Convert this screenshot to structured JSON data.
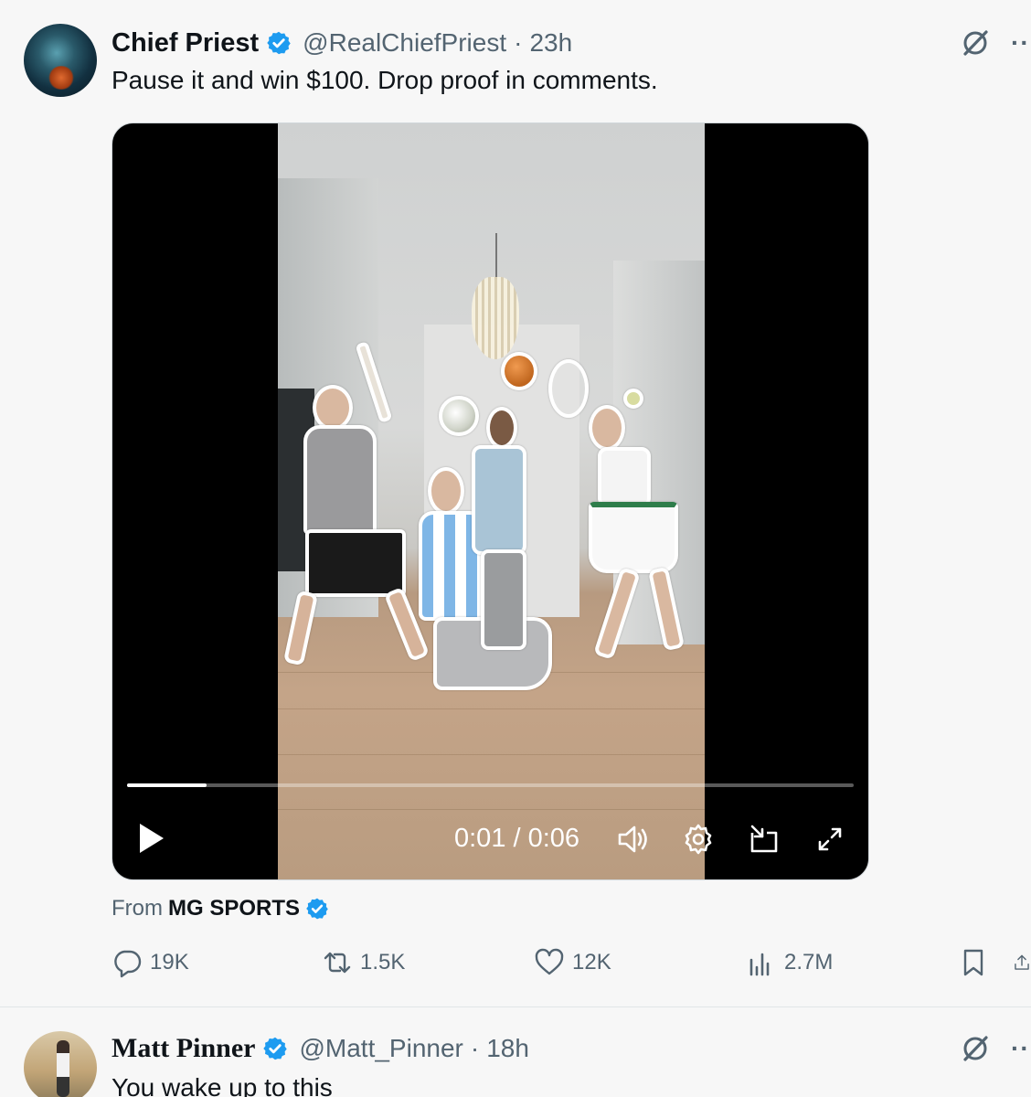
{
  "post": {
    "display_name": "Chief Priest",
    "handle": "@RealChiefPriest",
    "separator": "·",
    "time": "23h",
    "text": "Pause it and win $100. Drop proof in comments.",
    "video": {
      "current_time": "0:01",
      "duration": "0:06",
      "time_display": "0:01 / 0:06",
      "progress_fraction": 0.11
    },
    "from_prefix": "From",
    "from_source": "MG SPORTS",
    "actions": {
      "replies": "19K",
      "reposts": "1.5K",
      "likes": "12K",
      "views": "2.7M"
    }
  },
  "reply": {
    "display_name": "Matt Pinner",
    "handle": "@Matt_Pinner",
    "separator": "·",
    "time": "18h",
    "text": "You wake up to this"
  },
  "colors": {
    "verified_blue": "#1d9bf0",
    "secondary_text": "#536471",
    "background": "#f7f7f7"
  },
  "icons": [
    "verified-badge-icon",
    "grok-icon",
    "more-icon",
    "play-icon",
    "volume-icon",
    "settings-icon",
    "pip-icon",
    "fullscreen-icon",
    "reply-icon",
    "repost-icon",
    "like-icon",
    "views-icon",
    "bookmark-icon",
    "share-icon"
  ]
}
